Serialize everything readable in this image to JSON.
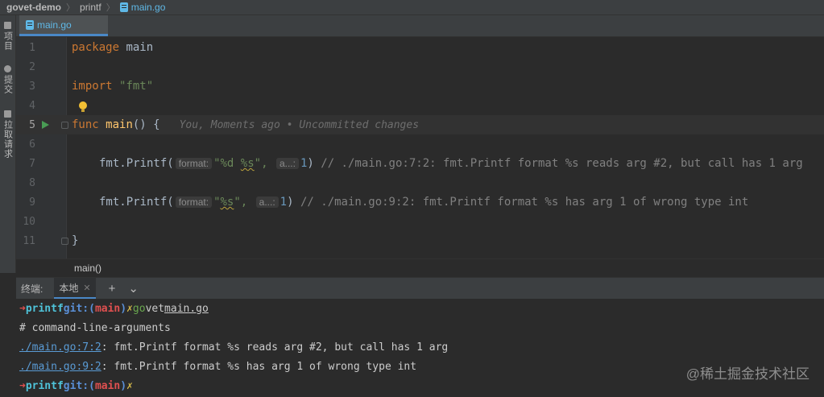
{
  "breadcrumb": {
    "project": "govet-demo",
    "folder": "printf",
    "file": "main.go"
  },
  "tool_strip": {
    "items": [
      "项目",
      "提交",
      "拉取请求"
    ]
  },
  "editor_tab": {
    "label": "main.go"
  },
  "editor": {
    "lines": [
      {
        "n": "1"
      },
      {
        "n": "2"
      },
      {
        "n": "3"
      },
      {
        "n": "4"
      },
      {
        "n": "5"
      },
      {
        "n": "6"
      },
      {
        "n": "7"
      },
      {
        "n": "8"
      },
      {
        "n": "9"
      },
      {
        "n": "10"
      },
      {
        "n": "11"
      }
    ],
    "l1": {
      "kw": "package",
      "name": "main"
    },
    "l3": {
      "kw": "import",
      "str": "\"fmt\""
    },
    "l5": {
      "kw": "func",
      "name": "main",
      "paren": "()",
      "brace": "{",
      "lens": "You, Moments ago • Uncommitted changes"
    },
    "l7": {
      "call": "fmt.Printf(",
      "hint1": "format:",
      "str_a": "\"%d ",
      "str_b": "%s",
      "str_c": "\",",
      "hint2": "a...:",
      "num": "1",
      "close": ")",
      "comment": "// ./main.go:7:2: fmt.Printf format %s reads arg #2, but call has 1 arg"
    },
    "l9": {
      "call": "fmt.Printf(",
      "hint1": "format:",
      "str_a": "\"",
      "str_b": "%s",
      "str_c": "\",",
      "hint2": "a...:",
      "num": "1",
      "close": ")",
      "comment": "// ./main.go:9:2: fmt.Printf format %s has arg 1 of wrong type int"
    },
    "l11": {
      "brace": "}"
    }
  },
  "code_breadcrumb": "main()",
  "terminal": {
    "title": "终端:",
    "tab_label": "本地",
    "add_symbol": "+",
    "dropdown_symbol": "⌄",
    "prompt_arrow": "➜",
    "prompt_dir": "printf",
    "prompt_git": "git:(",
    "prompt_branch": "main",
    "prompt_git_close": ")",
    "prompt_x": "✗",
    "cmd1": "go",
    "cmd2": "vet",
    "cmd_file": "main.go",
    "out1": "# command-line-arguments",
    "err1_loc": "./main.go:7:2",
    "err1_msg": ": fmt.Printf format %s reads arg #2, but call has 1 arg",
    "err2_loc": "./main.go:9:2",
    "err2_msg": ": fmt.Printf format %s has arg 1 of wrong type int"
  },
  "watermark": "@稀土掘金技术社区"
}
